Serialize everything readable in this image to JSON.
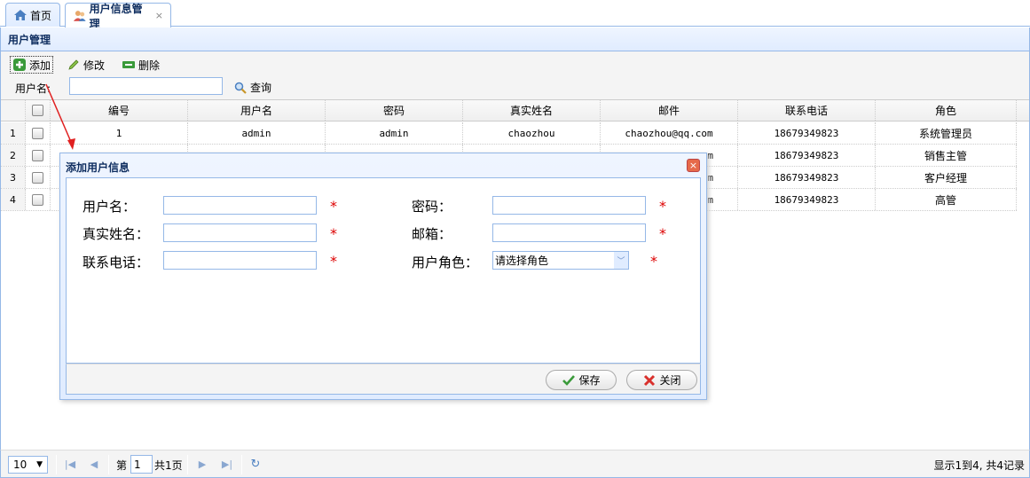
{
  "tabs": [
    {
      "label": "首页",
      "icon": "home-icon"
    },
    {
      "label": "用户信息管理",
      "icon": "users-icon",
      "close": "×"
    }
  ],
  "panel": {
    "title": "用户管理"
  },
  "toolbar": {
    "add_label": "添加",
    "edit_label": "修改",
    "delete_label": "删除"
  },
  "search": {
    "label": "用户名:",
    "value": "",
    "button_label": "查询"
  },
  "grid": {
    "columns": [
      "编号",
      "用户名",
      "密码",
      "真实姓名",
      "邮件",
      "联系电话",
      "角色"
    ],
    "rows": [
      {
        "num": "1",
        "cells": [
          "1",
          "admin",
          "admin",
          "chaozhou",
          "chaozhou@qq.com",
          "18679349823",
          "系统管理员"
        ]
      },
      {
        "num": "2",
        "cells": [
          "",
          "",
          "",
          "",
          "m",
          "18679349823",
          "销售主管"
        ]
      },
      {
        "num": "3",
        "cells": [
          "",
          "",
          "",
          "",
          "m",
          "18679349823",
          "客户经理"
        ]
      },
      {
        "num": "4",
        "cells": [
          "",
          "",
          "",
          "",
          "m",
          "18679349823",
          "高管"
        ]
      }
    ]
  },
  "pager": {
    "page_size": "10",
    "page_prefix": "第",
    "page_value": "1",
    "page_total": "共1页",
    "info": "显示1到4, 共4记录"
  },
  "dialog": {
    "title": "添加用户信息",
    "close": "×",
    "fields": {
      "username_label": "用户名：",
      "password_label": "密码：",
      "realname_label": "真实姓名：",
      "email_label": "邮箱：",
      "phone_label": "联系电话：",
      "role_label": "用户角色：",
      "role_value": "请选择角色",
      "required_mark": "*"
    },
    "save_label": "保存",
    "close_label": "关闭"
  },
  "colors": {
    "accent": "#95b8e7",
    "header": "#e0ecff",
    "required": "#dd0000"
  }
}
